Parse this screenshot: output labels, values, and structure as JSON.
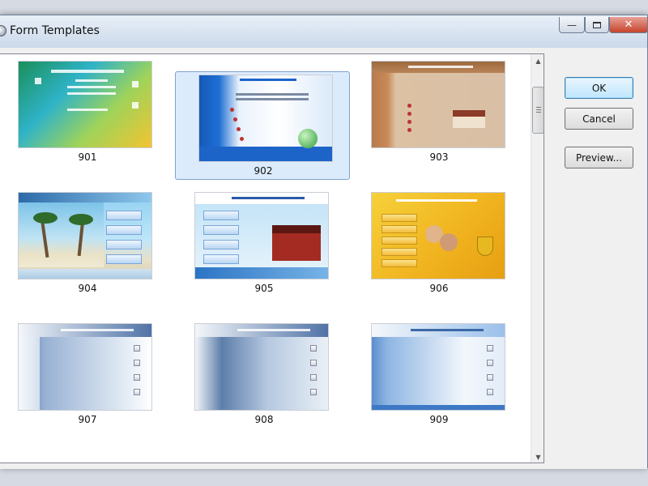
{
  "window": {
    "title": "Form Templates"
  },
  "templates": [
    {
      "label": "901"
    },
    {
      "label": "902"
    },
    {
      "label": "903"
    },
    {
      "label": "904"
    },
    {
      "label": "905"
    },
    {
      "label": "906"
    },
    {
      "label": "907"
    },
    {
      "label": "908"
    },
    {
      "label": "909"
    }
  ],
  "selected_template": "902",
  "buttons": {
    "ok": "OK",
    "cancel": "Cancel",
    "preview": "Preview..."
  },
  "colors": {
    "selection": "#dcebfc",
    "selection_border": "#7da2ce",
    "default_button": "#bee6fd"
  }
}
